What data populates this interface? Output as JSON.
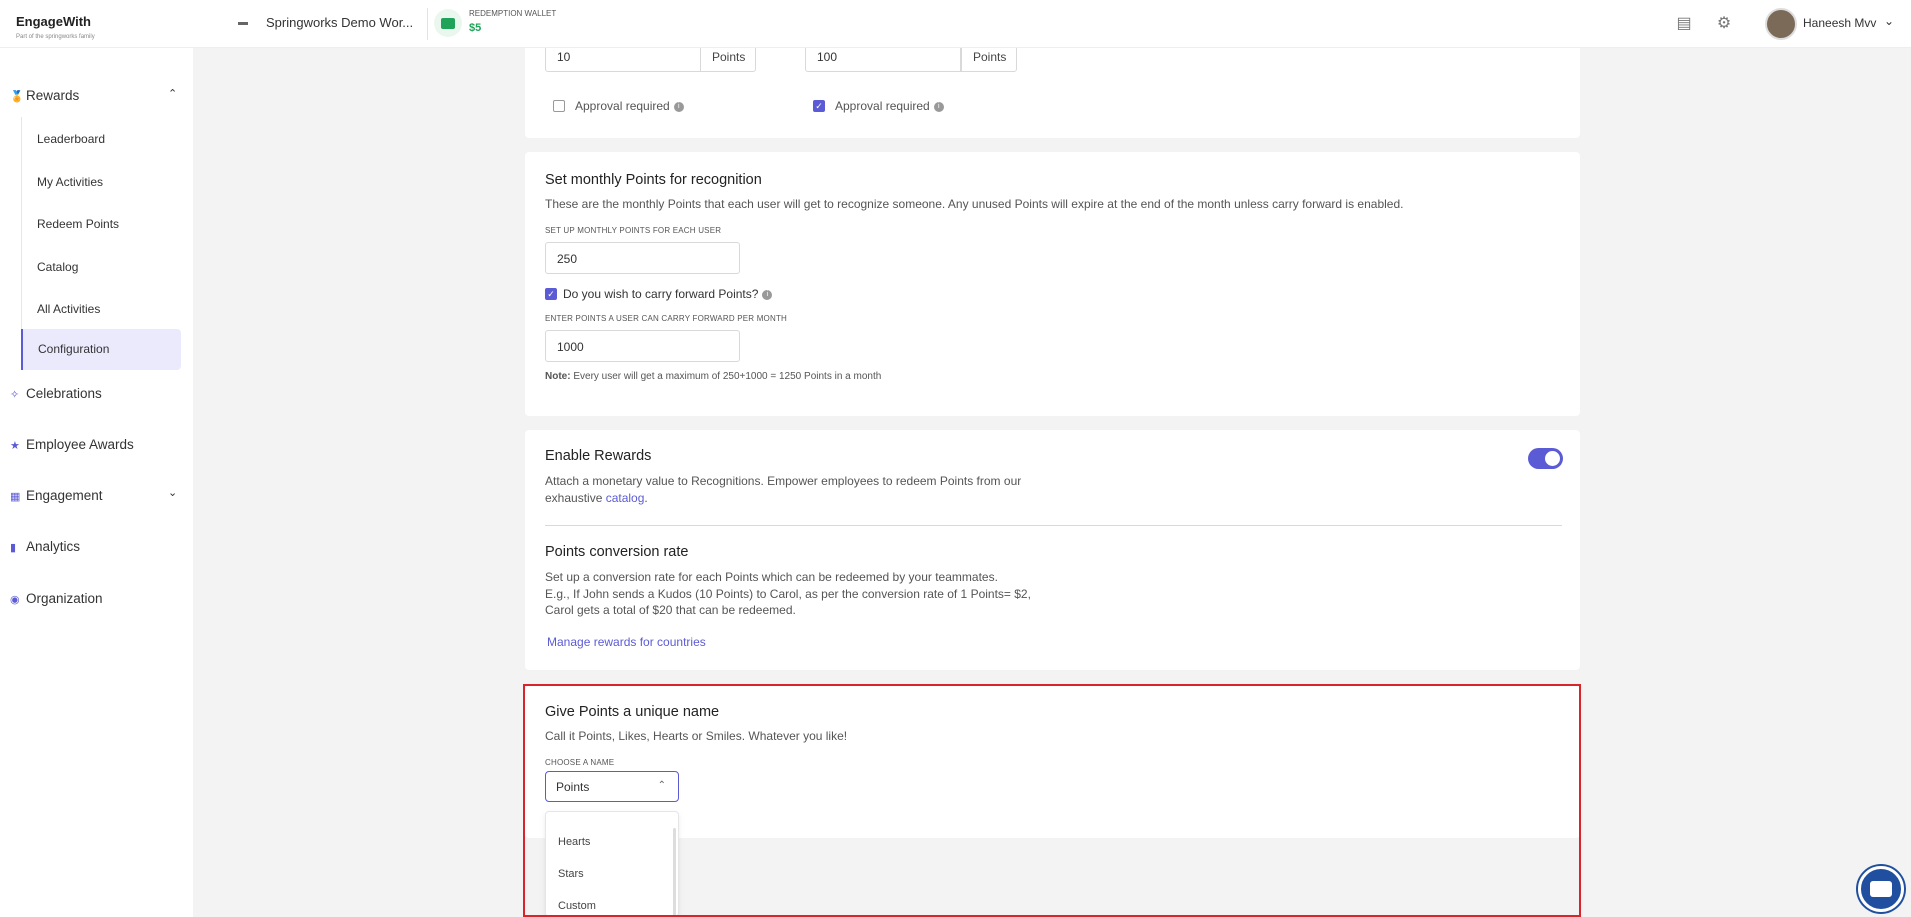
{
  "header": {
    "logo": "EngageWith",
    "logo_sub": "Part of the springworks family",
    "workspace": "Springworks Demo Wor...",
    "wallet_label": "REDEMPTION WALLET",
    "wallet_value": "$5",
    "user": "Haneesh Mvv",
    "icons": [
      "card-icon",
      "gear-icon",
      "chevron-down-icon"
    ]
  },
  "sidebar": {
    "rewards": "Rewards",
    "sub_items": [
      "Leaderboard",
      "My Activities",
      "Redeem Points",
      "Catalog",
      "All Activities",
      "Configuration"
    ],
    "active_item": "Configuration",
    "items": [
      "Celebrations",
      "Employee Awards",
      "Engagement",
      "Analytics",
      "Organization"
    ]
  },
  "top_card": {
    "value1": "10",
    "unit1": "Points",
    "value2": "100",
    "unit2": "Points",
    "approval1": "Approval required",
    "approval1_checked": false,
    "approval2": "Approval required",
    "approval2_checked": true
  },
  "monthly": {
    "title": "Set monthly Points for recognition",
    "desc": "These are the monthly Points that each user will get to recognize someone. Any unused Points will expire at the end of the month unless carry forward is enabled.",
    "label1": "SET UP MONTHLY POINTS FOR EACH USER",
    "value1": "250",
    "carry_label": "Do you wish to carry forward Points?",
    "carry_checked": true,
    "label2": "ENTER POINTS A USER CAN CARRY FORWARD PER MONTH",
    "value2": "1000",
    "note_bold": "Note:",
    "note": " Every user will get a maximum of 250+1000 = 1250 Points in a month"
  },
  "rewards": {
    "title": "Enable Rewards",
    "desc_line1": "Attach a monetary value to Recognitions. Empower employees to redeem Points from our",
    "desc_line2": "exhaustive ",
    "desc_link": "catalog",
    "desc_end": ".",
    "enabled": true,
    "conv_title": "Points conversion rate",
    "conv_line1": "Set up a conversion rate for each Points which can be redeemed by your teammates.",
    "conv_line2": "E.g., If John sends a Kudos (10 Points) to Carol, as per the conversion rate of 1 Points= $2,",
    "conv_line3": "Carol gets a total of $20 that can be redeemed.",
    "manage_link": "Manage rewards for countries"
  },
  "naming": {
    "title": "Give Points a unique name",
    "desc": "Call it Points, Likes, Hearts or Smiles. Whatever you like!",
    "label": "CHOOSE A NAME",
    "selected": "Points",
    "options": [
      "Hearts",
      "Stars",
      "Custom"
    ]
  },
  "colors": {
    "accent": "#5b5bd6",
    "highlight": "#d9242b",
    "wallet": "#1fa35a"
  }
}
